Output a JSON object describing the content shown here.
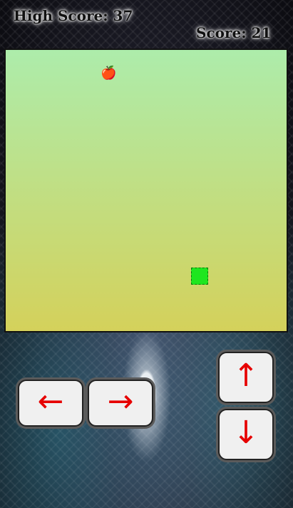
{
  "high_score_label": "High Score: 37",
  "score_label": "Score: 21",
  "game": {
    "apple_glyph": "🍎",
    "apple_color": "#d31f1f",
    "snake_color": "#1fe61f",
    "board_gradient_top": "#adecab",
    "board_gradient_bottom": "#d4d15b"
  },
  "controls": {
    "left": "←",
    "right": "→",
    "up": "↑",
    "down": "↓",
    "arrow_color": "#e60000"
  }
}
